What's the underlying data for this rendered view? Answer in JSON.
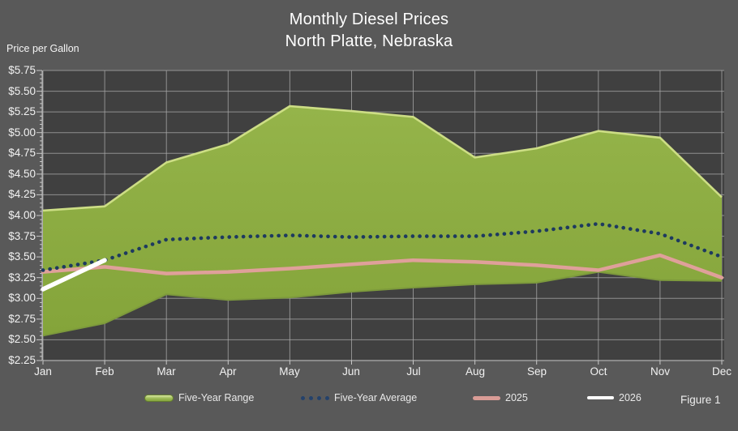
{
  "title": {
    "line1": "Monthly Diesel Prices",
    "line2": "North Platte, Nebraska"
  },
  "y_axis_label": "Price per Gallon",
  "figure_label": "Figure 1",
  "legend": [
    {
      "label": "Five-Year Range",
      "swatch": "green-area-swatch"
    },
    {
      "label": "Five-Year Average",
      "swatch": "navy-dotted-swatch"
    },
    {
      "label": "2025",
      "swatch": "pink-line-swatch"
    },
    {
      "label": "2026",
      "swatch": "white-line-swatch"
    }
  ],
  "colors": {
    "background": "#595959",
    "plot_background": "#404040",
    "gridline": "#aaaaaa",
    "axis": "#c8c8c8",
    "range_fill_top": "#95b44a",
    "range_fill_bottom": "#84a43a",
    "range_edge_light": "#cdde85",
    "range_edge_dark": "#7d9a3c",
    "avg_dotted": "#1e3a5f",
    "line_2025": "#dfa09a",
    "line_2026": "#ffffff",
    "text": "#f2f2f2"
  },
  "chart_data": {
    "type": "area",
    "title": "Monthly Diesel Prices — North Platte, Nebraska",
    "xlabel": "",
    "ylabel": "Price per Gallon",
    "ylim": [
      2.25,
      5.75
    ],
    "ytick_step": 0.25,
    "grid": true,
    "legend_position": "bottom",
    "categories": [
      "Jan",
      "Feb",
      "Mar",
      "Apr",
      "May",
      "Jun",
      "Jul",
      "Aug",
      "Sep",
      "Oct",
      "Nov",
      "Dec"
    ],
    "y_tick_labels": [
      "$5.75",
      "$5.50",
      "$5.25",
      "$5.00",
      "$4.75",
      "$4.50",
      "$4.25",
      "$4.00",
      "$3.75",
      "$3.50",
      "$3.25",
      "$3.00",
      "$2.75",
      "$2.50",
      "$2.25"
    ],
    "series": [
      {
        "name": "Five-Year Range",
        "type": "area-range",
        "max": [
          4.06,
          4.11,
          4.64,
          4.86,
          5.32,
          5.26,
          5.19,
          4.7,
          4.81,
          5.02,
          4.94,
          4.22
        ],
        "min": [
          2.55,
          2.7,
          3.05,
          2.98,
          3.01,
          3.08,
          3.13,
          3.17,
          3.19,
          3.32,
          3.22,
          3.21
        ]
      },
      {
        "name": "Five-Year Average",
        "type": "dotted-line",
        "values": [
          3.34,
          3.46,
          3.71,
          3.74,
          3.76,
          3.74,
          3.75,
          3.75,
          3.81,
          3.9,
          3.78,
          3.5
        ]
      },
      {
        "name": "2025",
        "type": "line",
        "values": [
          3.32,
          3.38,
          3.3,
          3.32,
          3.36,
          3.41,
          3.46,
          3.44,
          3.4,
          3.34,
          3.52,
          3.25
        ]
      },
      {
        "name": "2026",
        "type": "line",
        "values": [
          3.11,
          3.46,
          null,
          null,
          null,
          null,
          null,
          null,
          null,
          null,
          null,
          null
        ]
      }
    ]
  }
}
